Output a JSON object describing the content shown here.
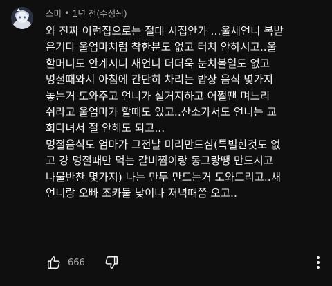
{
  "comment": {
    "author": "스미",
    "separator": "•",
    "timestamp": "1년 전(수정됨)",
    "lines": [
      "와 진짜 이런집으로는 절대 시집안가 ...울새언니 복받",
      "은거다 울엄마처럼 착한분도 없고 터치 안하시고..울",
      "할머니도 안계시니 새언니 더더욱 눈치볼일도 없고",
      "명절때와서 아침에 간단히 차리는 밥상 음식 몇가지",
      "놓는거 도와주고 언니가 설거지하고 어쩔땐 며느리",
      "쉬라고 울엄마가 할때도 있고..산소가서도 언니는 교",
      "회다녀서 절 안해도 되고...",
      "명절음식도 엄마가 그전날 미리만드심(특별한것도 없",
      "고 걍 명절때만 먹는 갈비찜이랑 동그랑땡 만드시고",
      "나물반찬 몇가지) 나는 만두 만드는거 도와드리고..새",
      "언니랑 오빠 조카둘 낮이나 저녁때쯤 오고.."
    ],
    "like_count": "666"
  },
  "icons": {
    "like": "thumbs-up-icon",
    "dislike": "thumbs-down-icon",
    "more": "vertical-dots-icon"
  },
  "colors": {
    "background": "#0f0f0f",
    "text_primary": "#f1f1f1",
    "text_secondary": "#aaaaaa"
  }
}
